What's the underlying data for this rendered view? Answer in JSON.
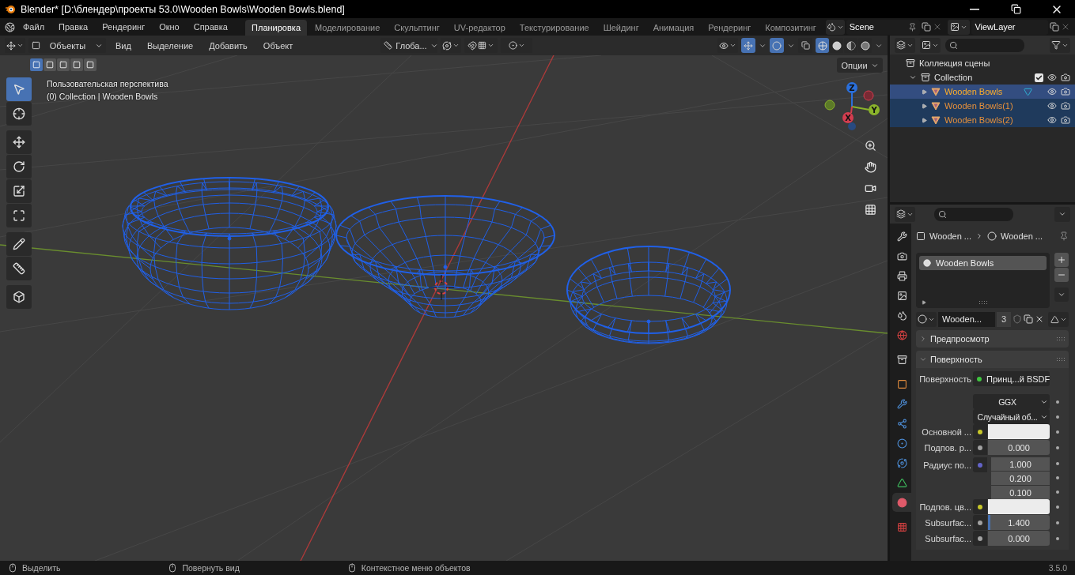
{
  "window": {
    "title": "Blender* [D:\\блендер\\проекты 53.0\\Wooden Bowls\\Wooden Bowls.blend]"
  },
  "menu": [
    "Файл",
    "Правка",
    "Рендеринг",
    "Окно",
    "Справка"
  ],
  "workspaces": [
    {
      "label": "Планировка",
      "selected": true
    },
    {
      "label": "Моделирование",
      "selected": false
    },
    {
      "label": "Скульптинг",
      "selected": false
    },
    {
      "label": "UV-редактор",
      "selected": false
    },
    {
      "label": "Текстурирование",
      "selected": false
    },
    {
      "label": "Шейдинг",
      "selected": false
    },
    {
      "label": "Анимация",
      "selected": false
    },
    {
      "label": "Рендеринг",
      "selected": false
    },
    {
      "label": "Композитинг",
      "selected": false
    }
  ],
  "scene": "Scene",
  "view_layer": "ViewLayer",
  "viewport": {
    "mode": "Объекты",
    "menus": [
      "Вид",
      "Выделение",
      "Добавить",
      "Объект"
    ],
    "orientation": "Глоба...",
    "options": "Опции",
    "gizmos_on": true,
    "overlays_on": true,
    "shading": [
      {
        "kind": "wireframe",
        "selected": true
      },
      {
        "kind": "solid",
        "selected": false
      },
      {
        "kind": "material",
        "selected": false
      },
      {
        "kind": "rendered",
        "selected": false
      }
    ],
    "select_modes": [
      {
        "selected": true
      },
      {
        "selected": false
      },
      {
        "selected": false
      },
      {
        "selected": false
      },
      {
        "selected": false
      }
    ],
    "view_name": "Пользовательская перспектива",
    "context": "(0) Collection | Wooden Bowls",
    "tools": [
      {
        "kind": "select",
        "selected": true
      },
      {
        "kind": "cursor",
        "selected": false
      },
      {
        "kind": "move",
        "selected": false
      },
      {
        "kind": "rotate",
        "selected": false
      },
      {
        "kind": "scale",
        "selected": false
      },
      {
        "kind": "transform",
        "selected": false
      },
      {
        "kind": "annotate",
        "selected": false
      },
      {
        "kind": "measure",
        "selected": false
      },
      {
        "kind": "add_cube",
        "selected": false
      }
    ],
    "axes": [
      "X",
      "Y",
      "Z"
    ]
  },
  "outliner": {
    "root": "Коллекция сцены",
    "collection": {
      "label": "Collection",
      "expanded": true,
      "checked": true,
      "children": [
        {
          "label": "Wooden Bowls",
          "selected": true,
          "active": true,
          "expanded": false
        },
        {
          "label": "Wooden Bowls(1)",
          "selected": true,
          "active": false,
          "expanded": false
        },
        {
          "label": "Wooden Bowls(2)",
          "selected": true,
          "active": false,
          "expanded": false
        }
      ]
    }
  },
  "properties": {
    "tabs": [
      {
        "kind": "tool",
        "selected": false
      },
      {
        "kind": "render",
        "selected": false
      },
      {
        "kind": "output",
        "selected": false
      },
      {
        "kind": "view_layer",
        "selected": false
      },
      {
        "kind": "scene",
        "selected": false
      },
      {
        "kind": "world",
        "selected": false
      },
      {
        "kind": "collection",
        "selected": false
      },
      {
        "kind": "object",
        "selected": false
      },
      {
        "kind": "modifiers",
        "selected": false
      },
      {
        "kind": "particles",
        "selected": false
      },
      {
        "kind": "physics",
        "selected": false
      },
      {
        "kind": "constraints",
        "selected": false
      },
      {
        "kind": "data",
        "selected": false
      },
      {
        "kind": "material",
        "selected": true
      },
      {
        "kind": "texture",
        "selected": false
      }
    ],
    "breadcrumbs": [
      "Wooden ...",
      "Wooden ..."
    ],
    "slots": [
      {
        "label": "Wooden Bowls",
        "selected": true
      }
    ],
    "material": {
      "name": "Wooden...",
      "users": "3"
    },
    "panels": [
      {
        "label": "Предпросмотр",
        "expanded": false
      },
      {
        "label": "Поверхность",
        "expanded": true
      }
    ],
    "fields": [
      {
        "kind": "link",
        "label": "Поверхность",
        "value": "Принц...й BSDF",
        "color": "#3fc43f"
      },
      {
        "kind": "dropdown",
        "value": "GGX"
      },
      {
        "kind": "dropdown",
        "value": "Случайный об..."
      },
      {
        "kind": "color",
        "label": "Основной ...",
        "color": "#c7c729"
      },
      {
        "kind": "number",
        "label": "Подпов. р...",
        "value": "0.000",
        "color": "#a1a1a1"
      },
      {
        "kind": "vector",
        "label": "Радиус по...",
        "values": [
          "1.000",
          "0.200",
          "0.100"
        ],
        "color": "#6363c7"
      },
      {
        "kind": "color",
        "label": "Подпов. цв...",
        "color": "#c7c729"
      },
      {
        "kind": "number",
        "label": "Subsurfac...",
        "value": "1.400",
        "color": "#a1a1a1",
        "level": 0.04
      },
      {
        "kind": "number",
        "label": "Subsurfac...",
        "value": "0.000",
        "color": "#a1a1a1"
      }
    ]
  },
  "status": [
    "Выделить",
    "Повернуть вид",
    "Контекстное меню объектов"
  ],
  "version": "3.5.0"
}
